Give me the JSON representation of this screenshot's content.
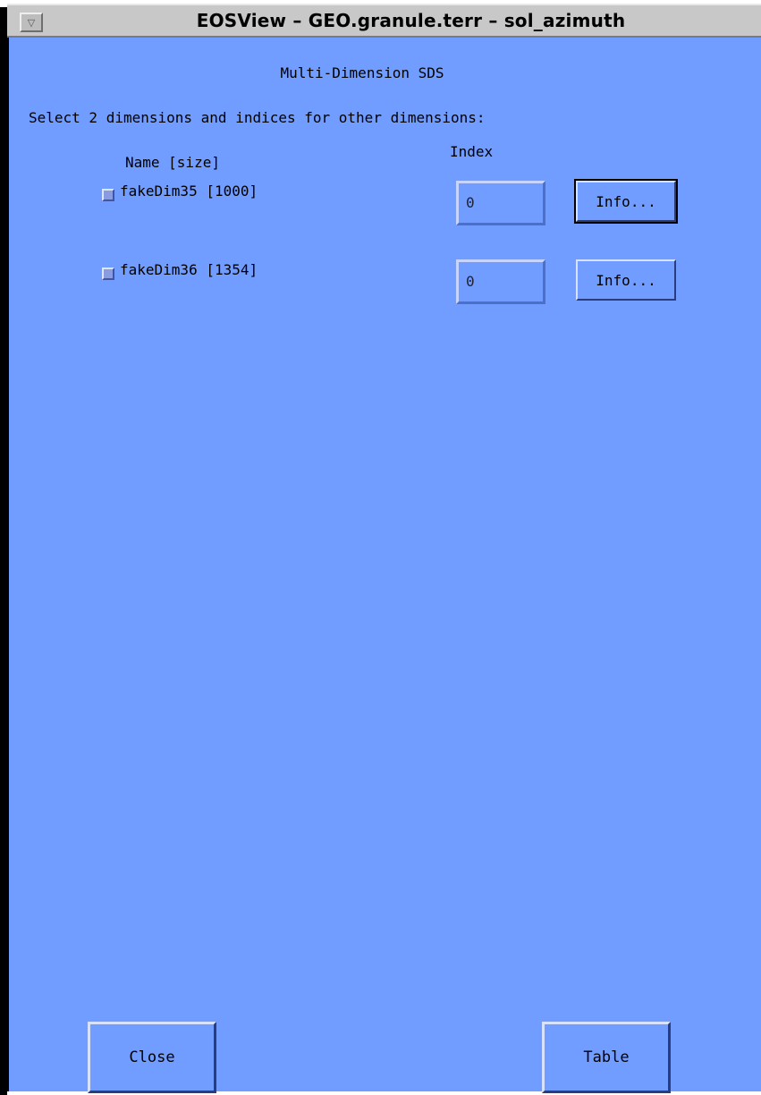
{
  "window": {
    "title": "EOSView – GEO.granule.terr – sol_azimuth",
    "menu_icon": "triangle-down-icon"
  },
  "dialog": {
    "heading": "Multi-Dimension SDS",
    "prompt": "Select 2 dimensions and indices for other dimensions:",
    "columns": {
      "name": "Name [size]",
      "index": "Index"
    },
    "dimensions": [
      {
        "label": "fakeDim35 [1000]",
        "index_value": "0",
        "info_label": "Info..."
      },
      {
        "label": "fakeDim36 [1354]",
        "index_value": "0",
        "info_label": "Info..."
      }
    ],
    "buttons": {
      "close": "Close",
      "table": "Table"
    }
  },
  "colors": {
    "panel_bg": "#709dff",
    "titlebar_bg": "#c8c8c8"
  }
}
